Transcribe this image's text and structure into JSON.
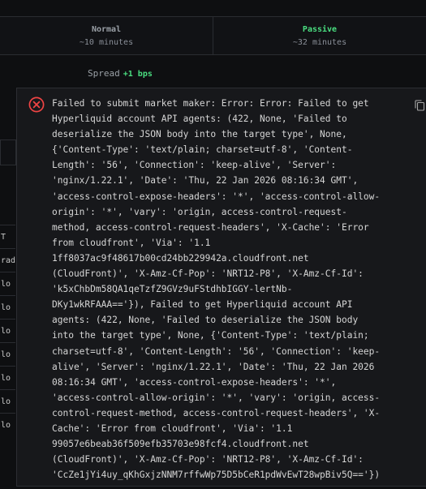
{
  "speed_options": [
    {
      "name": "Normal",
      "time": "~10 minutes"
    },
    {
      "name": "Passive",
      "time": "~32 minutes"
    }
  ],
  "spread": {
    "label": "Spread",
    "value": "+1 bps"
  },
  "background_cells": [
    "T",
    "rade",
    "lo",
    "lo",
    "lo",
    "lo",
    "lo",
    "lo",
    "lo"
  ],
  "toast": {
    "message_lines": [
      "Failed to submit market maker: Error: Error: Failed to get",
      "Hyperliquid account API agents: (422, None, 'Failed to",
      "deserialize the JSON body into the target type', None,",
      "{'Content-Type': 'text/plain; charset=utf-8', 'Content-",
      "Length': '56', 'Connection': 'keep-alive', 'Server':",
      "'nginx/1.22.1', 'Date': 'Thu, 22 Jan 2026 08:16:34 GMT',",
      "'access-control-expose-headers': '*', 'access-control-allow-",
      "origin': '*', 'vary': 'origin, access-control-request-",
      "method, access-control-request-headers', 'X-Cache': 'Error",
      "from cloudfront', 'Via': '1.1",
      "1ff8037ac9f48617b00cd24bb229942a.cloudfront.net",
      "(CloudFront)', 'X-Amz-Cf-Pop': 'NRT12-P8', 'X-Amz-Cf-Id':",
      "'k5xChbDm58QA1qeTzfZ9GVz9uFStdhbIGGY-lertNb-",
      "DKy1wkRFAAA=='}), Failed to get Hyperliquid account API",
      "agents: (422, None, 'Failed to deserialize the JSON body",
      "into the target type', None, {'Content-Type': 'text/plain;",
      "charset=utf-8', 'Content-Length': '56', 'Connection': 'keep-",
      "alive', 'Server': 'nginx/1.22.1', 'Date': 'Thu, 22 Jan 2026",
      "08:16:34 GMT', 'access-control-expose-headers': '*',",
      "'access-control-allow-origin': '*', 'vary': 'origin, access-",
      "control-request-method, access-control-request-headers', 'X-",
      "Cache': 'Error from cloudfront', 'Via': '1.1",
      "99057e6beab36f509efb35703e98fcf4.cloudfront.net",
      "(CloudFront)', 'X-Amz-Cf-Pop': 'NRT12-P8', 'X-Amz-Cf-Id':",
      "'CcZe1jYi4uy_qKhGxjzNNM7rffwWp75D5bCeR1pdWvEwT28wpBiv5Q=='})"
    ],
    "error_icon": "error-x-icon",
    "copy_icon": "copy-icon"
  },
  "colors": {
    "accent": "#4ade80",
    "error": "#ef4444",
    "background": "#0e0f11"
  }
}
